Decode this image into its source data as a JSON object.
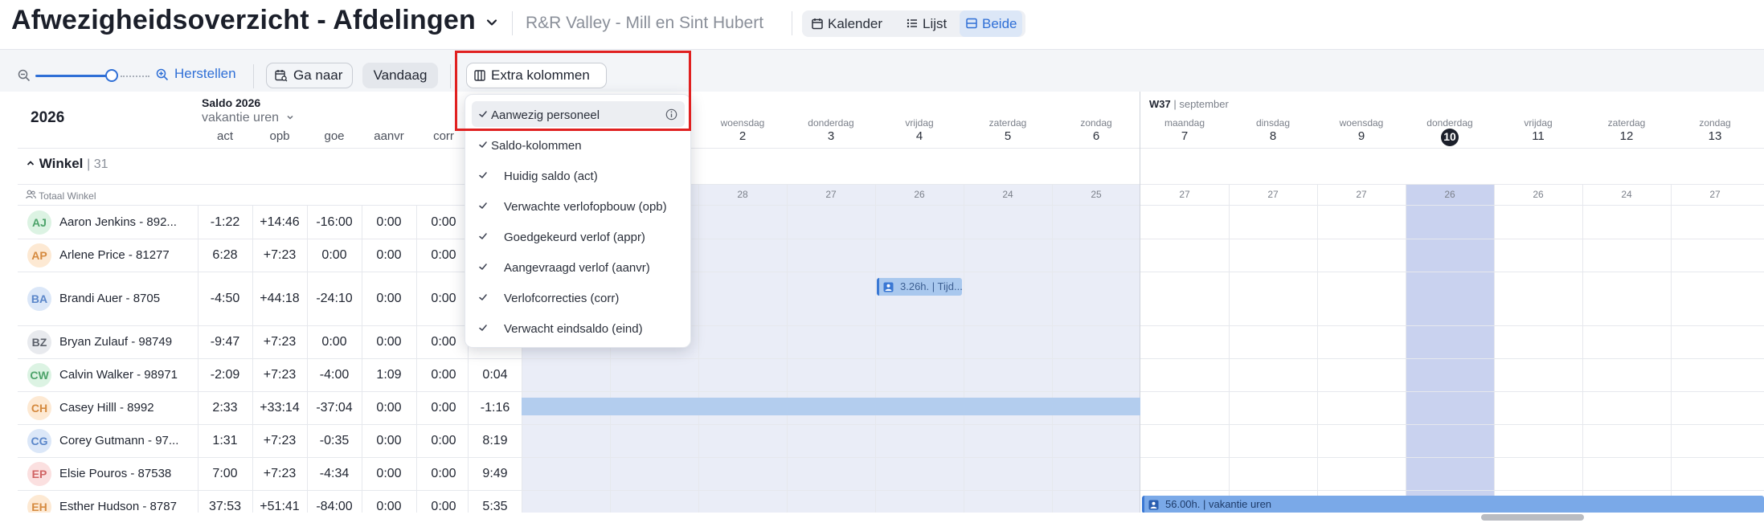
{
  "header": {
    "title": "Afwezigheidsoverzicht - Afdelingen",
    "location": "R&R Valley - Mill en Sint Hubert",
    "views": [
      {
        "label": "Kalender",
        "icon": "calendar-icon",
        "active": false
      },
      {
        "label": "Lijst",
        "icon": "list-icon",
        "active": false
      },
      {
        "label": "Beide",
        "icon": "split-view-icon",
        "active": true
      }
    ]
  },
  "toolbar": {
    "zoom_level": 0.75,
    "reset_label": "Herstellen",
    "goto_label": "Ga naar",
    "today_label": "Vandaag",
    "extra_columns_label": "Extra kolommen"
  },
  "dropdown": {
    "items": [
      {
        "label": "Aanwezig personeel",
        "checked": true,
        "info": true,
        "indent": false
      },
      {
        "label": "Saldo-kolommen",
        "checked": true,
        "info": false,
        "indent": false
      },
      {
        "label": "Huidig saldo (act)",
        "checked": true,
        "info": false,
        "indent": true
      },
      {
        "label": "Verwachte verlofopbouw (opb)",
        "checked": true,
        "info": false,
        "indent": true
      },
      {
        "label": "Goedgekeurd verlof (appr)",
        "checked": true,
        "info": false,
        "indent": true
      },
      {
        "label": "Aangevraagd verlof (aanvr)",
        "checked": true,
        "info": false,
        "indent": true
      },
      {
        "label": "Verlofcorrecties (corr)",
        "checked": true,
        "info": false,
        "indent": true
      },
      {
        "label": "Verwacht eindsaldo (eind)",
        "checked": true,
        "info": false,
        "indent": true
      }
    ]
  },
  "grid": {
    "year": "2026",
    "saldo_title": "Saldo 2026",
    "saldo_unit": "vakantie uren",
    "columns": [
      "act",
      "opb",
      "goe",
      "aanvr",
      "corr"
    ],
    "week_label": "W37",
    "month_label": "| september",
    "days_prev": [
      {
        "name": "woensdag",
        "num": "2",
        "count": "28"
      },
      {
        "name": "donderdag",
        "num": "3",
        "count": "27"
      },
      {
        "name": "vrijdag",
        "num": "4",
        "count": "26"
      },
      {
        "name": "zaterdag",
        "num": "5",
        "count": "24"
      },
      {
        "name": "zondag",
        "num": "6",
        "count": "25"
      }
    ],
    "hidden_counts": [
      "",
      ""
    ],
    "days_w37": [
      {
        "name": "maandag",
        "num": "7",
        "count": "27",
        "today": false
      },
      {
        "name": "dinsdag",
        "num": "8",
        "count": "27",
        "today": false
      },
      {
        "name": "woensdag",
        "num": "9",
        "count": "27",
        "today": false
      },
      {
        "name": "donderdag",
        "num": "10",
        "count": "26",
        "today": true
      },
      {
        "name": "vrijdag",
        "num": "11",
        "count": "26",
        "today": false
      },
      {
        "name": "zaterdag",
        "num": "12",
        "count": "24",
        "today": false
      },
      {
        "name": "zondag",
        "num": "13",
        "count": "27",
        "today": false
      }
    ],
    "group": {
      "name": "Winkel",
      "count": "| 31",
      "total_label": "Totaal Winkel"
    },
    "rows": [
      {
        "initials": "AJ",
        "name": "Aaron Jenkins - 892...",
        "color": "green",
        "act": "-1:22",
        "opb": "+14:46",
        "goe": "-16:00",
        "aanvr": "0:00",
        "corr": "0:00",
        "eind": ""
      },
      {
        "initials": "AP",
        "name": "Arlene Price - 81277",
        "color": "orange",
        "act": "6:28",
        "opb": "+7:23",
        "goe": "0:00",
        "aanvr": "0:00",
        "corr": "0:00",
        "eind": ""
      },
      {
        "initials": "BA",
        "name": "Brandi Auer - 8705",
        "color": "blue",
        "act": "-4:50",
        "opb": "+44:18",
        "goe": "-24:10",
        "aanvr": "0:00",
        "corr": "0:00",
        "eind": ""
      },
      {
        "initials": "BZ",
        "name": "Bryan Zulauf - 98749",
        "color": "gray",
        "act": "-9:47",
        "opb": "+7:23",
        "goe": "0:00",
        "aanvr": "0:00",
        "corr": "0:00",
        "eind": ""
      },
      {
        "initials": "CW",
        "name": "Calvin Walker - 98971",
        "color": "green",
        "act": "-2:09",
        "opb": "+7:23",
        "goe": "-4:00",
        "aanvr": "1:09",
        "corr": "0:00",
        "eind": "0:04"
      },
      {
        "initials": "CH",
        "name": "Casey Hilll - 8992",
        "color": "orange",
        "act": "2:33",
        "opb": "+33:14",
        "goe": "-37:04",
        "aanvr": "0:00",
        "corr": "0:00",
        "eind": "-1:16"
      },
      {
        "initials": "CG",
        "name": "Corey Gutmann - 97...",
        "color": "blue",
        "act": "1:31",
        "opb": "+7:23",
        "goe": "-0:35",
        "aanvr": "0:00",
        "corr": "0:00",
        "eind": "8:19"
      },
      {
        "initials": "EP",
        "name": "Elsie Pouros - 87538",
        "color": "red",
        "act": "7:00",
        "opb": "+7:23",
        "goe": "-4:34",
        "aanvr": "0:00",
        "corr": "0:00",
        "eind": "9:49"
      },
      {
        "initials": "EH",
        "name": "Esther Hudson - 8787",
        "color": "orange",
        "act": "37:53",
        "opb": "+51:41",
        "goe": "-84:00",
        "aanvr": "0:00",
        "corr": "0:00",
        "eind": "5:35"
      }
    ],
    "events": [
      {
        "label": "3.26h. | Tijd...",
        "row": 2
      },
      {
        "label": "56.00h. | vakantie uren",
        "row": 8
      }
    ]
  }
}
